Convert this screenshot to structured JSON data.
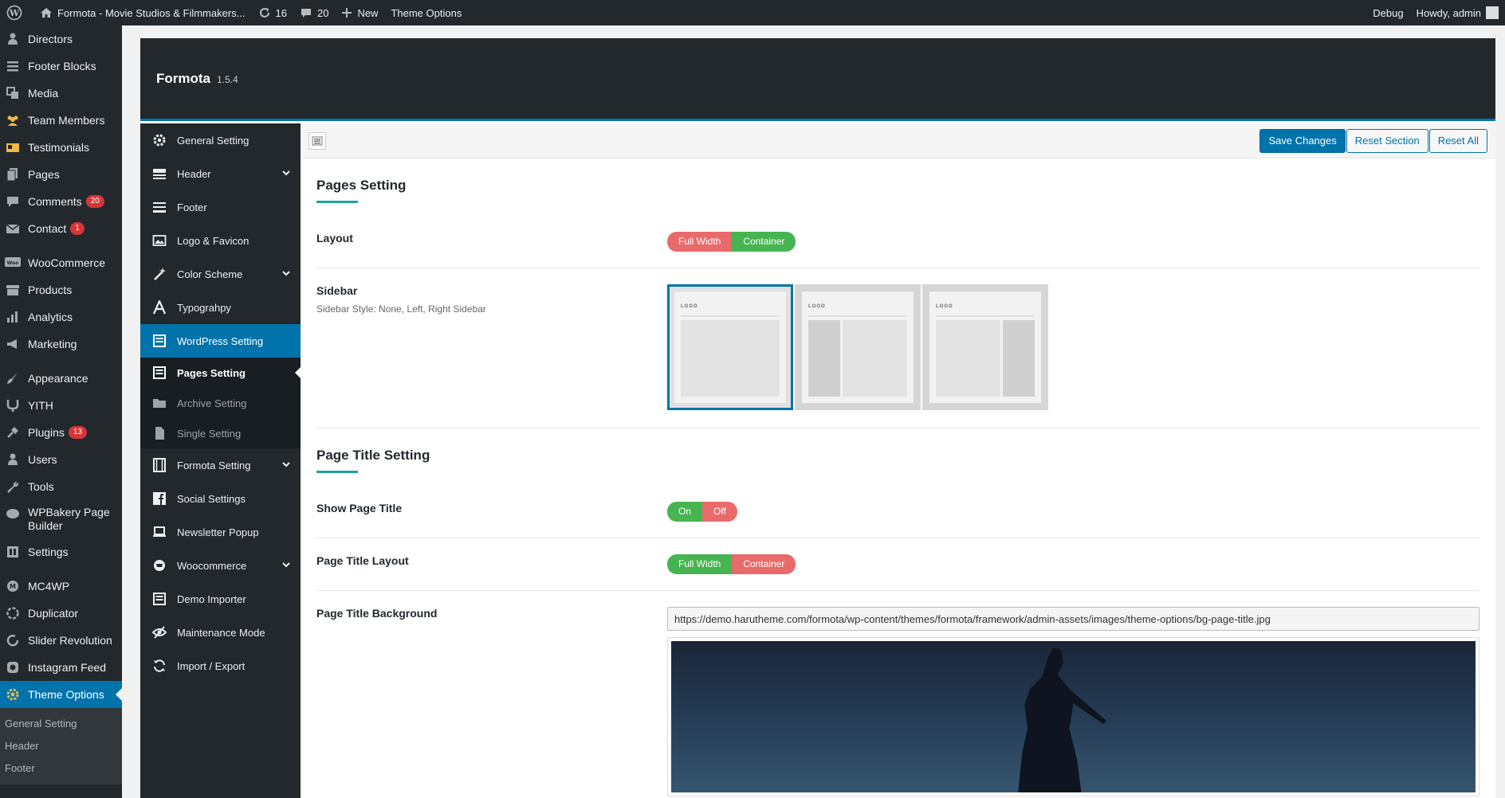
{
  "adminbar": {
    "site_title": "Formota - Movie Studios & Filmmakers...",
    "updates_count": "16",
    "comments_count": "20",
    "new_label": "New",
    "theme_options_label": "Theme Options",
    "debug_label": "Debug",
    "howdy_label": "Howdy, admin"
  },
  "adminmenu": {
    "items": [
      {
        "label": "Directors"
      },
      {
        "label": "Footer Blocks"
      },
      {
        "label": "Media"
      },
      {
        "label": "Team Members"
      },
      {
        "label": "Testimonials"
      },
      {
        "label": "Pages"
      },
      {
        "label": "Comments",
        "badge": "20"
      },
      {
        "label": "Contact",
        "badge": "1"
      },
      {
        "label": "WooCommerce"
      },
      {
        "label": "Products"
      },
      {
        "label": "Analytics"
      },
      {
        "label": "Marketing"
      },
      {
        "label": "Appearance"
      },
      {
        "label": "YITH"
      },
      {
        "label": "Plugins",
        "badge": "13"
      },
      {
        "label": "Users"
      },
      {
        "label": "Tools"
      },
      {
        "label": "WPBakery Page Builder"
      },
      {
        "label": "Settings"
      },
      {
        "label": "MC4WP"
      },
      {
        "label": "Duplicator"
      },
      {
        "label": "Slider Revolution"
      },
      {
        "label": "Instagram Feed"
      },
      {
        "label": "Theme Options"
      }
    ],
    "submenu": [
      "General Setting",
      "Header",
      "Footer"
    ]
  },
  "panel": {
    "title": "Formota",
    "version": "1.5.4",
    "nav": [
      {
        "label": "General Setting"
      },
      {
        "label": "Header"
      },
      {
        "label": "Footer"
      },
      {
        "label": "Logo & Favicon"
      },
      {
        "label": "Color Scheme"
      },
      {
        "label": "Typograhpy"
      },
      {
        "label": "WordPress Setting"
      },
      {
        "label": "Formota Setting"
      },
      {
        "label": "Social Settings"
      },
      {
        "label": "Newsletter Popup"
      },
      {
        "label": "Woocommerce"
      },
      {
        "label": "Demo Importer"
      },
      {
        "label": "Maintenance Mode"
      },
      {
        "label": "Import / Export"
      }
    ],
    "nav_sub": [
      "Pages Setting",
      "Archive Setting",
      "Single Setting"
    ],
    "toolbar": {
      "save": "Save Changes",
      "reset_section": "Reset Section",
      "reset_all": "Reset All"
    }
  },
  "content": {
    "section1_title": "Pages Setting",
    "layout": {
      "label": "Layout",
      "opt1": "Full Width",
      "opt2": "Container",
      "selected": "Container"
    },
    "sidebar": {
      "label": "Sidebar",
      "desc": "Sidebar Style: None, Left, Right Sidebar",
      "logo_text": "LOGO",
      "selected": "None"
    },
    "section2_title": "Page Title Setting",
    "show_title": {
      "label": "Show Page Title",
      "on": "On",
      "off": "Off",
      "selected": "On"
    },
    "title_layout": {
      "label": "Page Title Layout",
      "opt1": "Full Width",
      "opt2": "Container",
      "selected": "Full Width"
    },
    "title_bg": {
      "label": "Page Title Background",
      "url": "https://demo.harutheme.com/formota/wp-content/themes/formota/framework/admin-assets/images/theme-options/bg-page-title.jpg"
    }
  }
}
